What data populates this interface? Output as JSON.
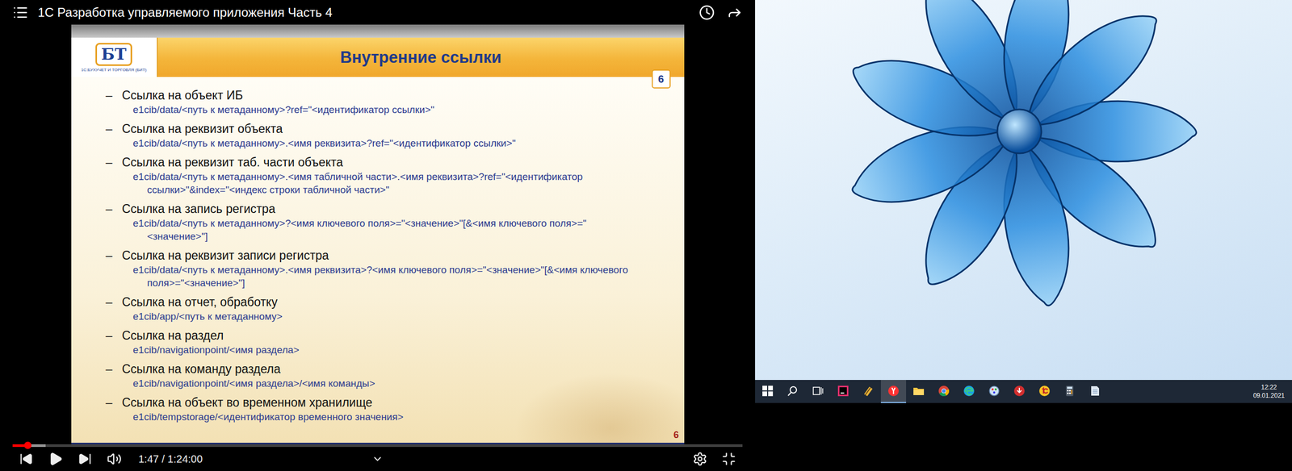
{
  "player": {
    "title": "1С Разработка управляемого приложения Часть 4",
    "time": "1:47 / 1:24:00",
    "paused": true,
    "progress": 0.021,
    "buffered": 0.045
  },
  "slide": {
    "logo": "БТ",
    "logo_caption": "1С:БУХУЧЕТ И ТОРГОВЛЯ (БИТ)",
    "title": "Внутренние ссылки",
    "page_badge": "6",
    "page_number": "6",
    "bullet": "–",
    "items": [
      {
        "title": "Ссылка на объект ИБ",
        "code": "e1cib/data/<путь к метаданному>?ref=\"<идентификатор ссылки>\""
      },
      {
        "title": "Ссылка на реквизит объекта",
        "code": "e1cib/data/<путь к метаданному>.<имя реквизита>?ref=\"<идентификатор ссылки>\""
      },
      {
        "title": "Ссылка на реквизит таб. части объекта",
        "code": "e1cib/data/<путь к метаданному>.<имя табличной части>.<имя реквизита>?ref=\"<идентификатор ссылки>\"&index=\"<индекс строки табличной части>\""
      },
      {
        "title": "Ссылка на запись регистра",
        "code": "e1cib/data/<путь к метаданному>?<имя ключевого поля>=\"<значение>\"[&<имя ключевого поля>=\"<значение>\"]"
      },
      {
        "title": "Ссылка на реквизит записи регистра",
        "code": "e1cib/data/<путь к метаданному>.<имя реквизита>?<имя ключевого поля>=\"<значение>\"[&<имя ключевого поля>=\"<значение>\"]"
      },
      {
        "title": "Ссылка на отчет, обработку",
        "code": "e1cib/app/<путь к метаданному>"
      },
      {
        "title": "Ссылка на раздел",
        "code": "e1cib/navigationpoint/<имя раздела>"
      },
      {
        "title": "Ссылка на команду раздела",
        "code": "e1cib/navigationpoint/<имя раздела>/<имя команды>"
      },
      {
        "title": "Ссылка на объект во временном хранилище",
        "code": "e1cib/tempstorage/<идентификатор временного значения>"
      }
    ]
  },
  "desktop": {
    "taskbar": [
      {
        "kind": "start",
        "active": false
      },
      {
        "kind": "search",
        "active": false
      },
      {
        "kind": "taskview",
        "active": false
      },
      {
        "kind": "jetbrains",
        "active": false
      },
      {
        "kind": "tool",
        "active": false
      },
      {
        "kind": "yandex",
        "active": true
      },
      {
        "kind": "explorer",
        "active": false
      },
      {
        "kind": "chrome",
        "active": false
      },
      {
        "kind": "edge",
        "active": false
      },
      {
        "kind": "paint",
        "active": false
      },
      {
        "kind": "download",
        "active": false
      },
      {
        "kind": "onec",
        "active": false
      },
      {
        "kind": "calculator",
        "active": false
      },
      {
        "kind": "notepad",
        "active": false
      }
    ],
    "clock": {
      "time": "12:22",
      "date": "09.01.2021"
    }
  }
}
